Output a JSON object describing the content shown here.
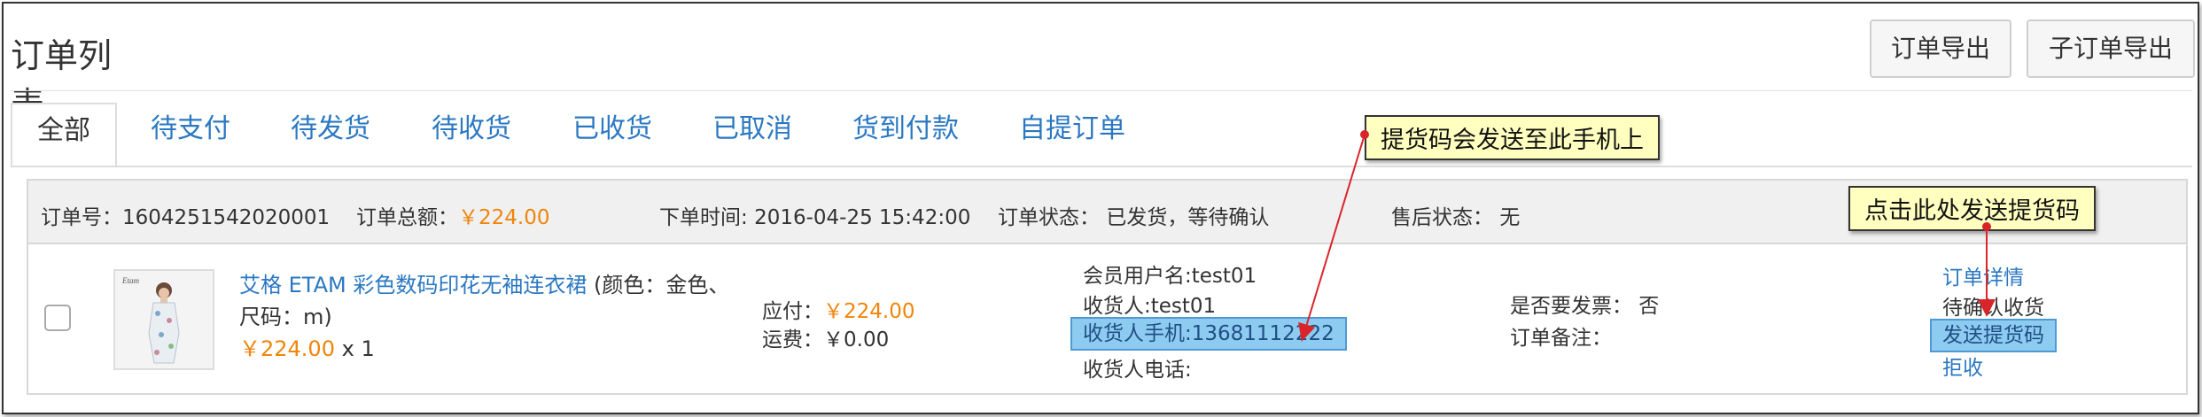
{
  "header": {
    "title": "订单列表",
    "export_label": "订单导出",
    "sub_export_label": "子订单导出"
  },
  "tabs": [
    {
      "label": "全部",
      "active": true
    },
    {
      "label": "待支付"
    },
    {
      "label": "待发货"
    },
    {
      "label": "待收货"
    },
    {
      "label": "已收货"
    },
    {
      "label": "已取消"
    },
    {
      "label": "货到付款"
    },
    {
      "label": "自提订单"
    }
  ],
  "order": {
    "number_label": "订单号：",
    "number": "1604251542020001",
    "total_label": "订单总额：",
    "total": "￥224.00",
    "time_label": "下单时间: ",
    "time": "2016-04-25 15:42:00",
    "status_label": "订单状态：",
    "status": "已发货，等待确认",
    "aftersale_label": "售后状态：",
    "aftersale": "无",
    "product_name": "艾格 ETAM 彩色数码印花无袖连衣裙",
    "product_attrs": "(颜色：金色、尺码：m)",
    "product_price": "￥224.00",
    "product_qty": "x 1",
    "payable_label": "应付：",
    "payable": "￥224.00",
    "shipping_label": "运费：",
    "shipping": "￥0.00",
    "member": "会员用户名:test01",
    "receiver": "收货人:test01",
    "receiver_phone": "收货人手机:13681112222",
    "receiver_tel": "收货人电话:",
    "invoice": "是否要发票： 否",
    "remark": "订单备注：",
    "action_detail": "订单详情",
    "action_status": "待确认收货",
    "action_send_code": "发送提货码",
    "action_reject": "拒收"
  },
  "callouts": {
    "phone_note": "提货码会发送至此手机上",
    "click_note": "点击此处发送提货码"
  },
  "colors": {
    "accent": "#2b78c2",
    "price": "#f0850a",
    "highlight": "#8ecbf1",
    "callout_bg": "#ffffc0",
    "arrow": "#d9252a"
  }
}
